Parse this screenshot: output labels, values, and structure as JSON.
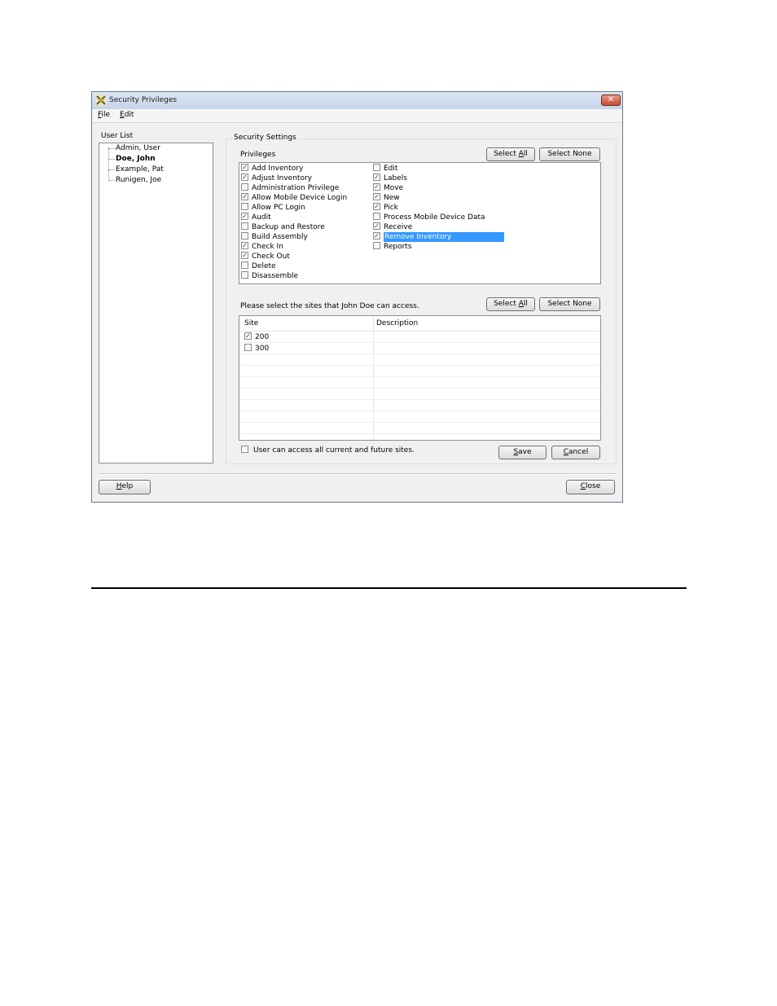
{
  "window": {
    "title": "Security Privileges",
    "close_glyph": "✕",
    "app_icon": "tools-icon"
  },
  "menu": [
    {
      "first": "F",
      "rest": "ile"
    },
    {
      "first": "E",
      "rest": "dit"
    }
  ],
  "user_list": {
    "label": "User List",
    "users": [
      {
        "name": "Admin, User",
        "selected": false
      },
      {
        "name": "Doe, John",
        "selected": true
      },
      {
        "name": "Example, Pat",
        "selected": false
      },
      {
        "name": "Runigen, Joe",
        "selected": false
      }
    ]
  },
  "security": {
    "group_label": "Security Settings",
    "privileges_label": "Privileges",
    "select_all": {
      "pre": "Select ",
      "key": "A",
      "post": "ll"
    },
    "select_none": "Select None",
    "privileges_left": [
      {
        "label": "Add Inventory",
        "checked": true
      },
      {
        "label": "Adjust Inventory",
        "checked": true
      },
      {
        "label": "Administration Privilege",
        "checked": false
      },
      {
        "label": "Allow Mobile Device Login",
        "checked": true
      },
      {
        "label": "Allow PC Login",
        "checked": false
      },
      {
        "label": "Audit",
        "checked": true
      },
      {
        "label": "Backup and Restore",
        "checked": false
      },
      {
        "label": "Build Assembly",
        "checked": false
      },
      {
        "label": "Check In",
        "checked": true
      },
      {
        "label": "Check Out",
        "checked": true
      },
      {
        "label": "Delete",
        "checked": false
      },
      {
        "label": "Disassemble",
        "checked": false
      }
    ],
    "privileges_right": [
      {
        "label": "Edit",
        "checked": false
      },
      {
        "label": "Labels",
        "checked": true
      },
      {
        "label": "Move",
        "checked": true
      },
      {
        "label": "New",
        "checked": true
      },
      {
        "label": "Pick",
        "checked": true
      },
      {
        "label": "Process Mobile Device Data",
        "checked": false
      },
      {
        "label": "Receive",
        "checked": true
      },
      {
        "label": "Remove Inventory",
        "checked": true,
        "highlighted": true
      },
      {
        "label": "Reports",
        "checked": false
      }
    ],
    "sites_prompt": "Please select the sites that John Doe can access.",
    "sites_columns": {
      "site": "Site",
      "description": "Description"
    },
    "sites": [
      {
        "site": "200",
        "description": "",
        "checked": true
      },
      {
        "site": "300",
        "description": "",
        "checked": false
      }
    ],
    "all_sites_label": "User can access all current and future sites.",
    "all_sites_checked": false,
    "save": {
      "key": "S",
      "rest": "ave"
    },
    "cancel": {
      "key": "C",
      "rest": "ancel"
    }
  },
  "footer": {
    "help": {
      "key": "H",
      "rest": "elp"
    },
    "close": {
      "key": "C",
      "rest": "lose"
    }
  },
  "check_glyph": "✓"
}
